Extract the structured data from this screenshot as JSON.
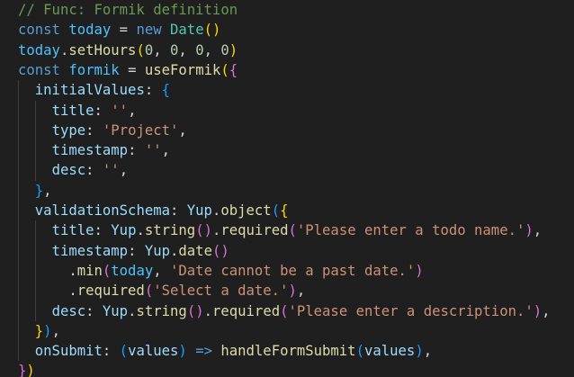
{
  "editor": {
    "theme": {
      "background": "#1f1f1f",
      "comment": "#6a9955",
      "keyword": "#569cd6",
      "variable": "#4fc1ff",
      "property": "#9cdcfe",
      "function": "#dcdcaa",
      "class": "#4ec9b0",
      "number": "#b5cea8",
      "string": "#ce9178",
      "bracket_level_1": "#ffd700",
      "bracket_level_2": "#da70d6",
      "bracket_level_3": "#179fff"
    },
    "lines": [
      [
        [
          "comment",
          "// Func: Formik definition"
        ]
      ],
      [
        [
          "keyword",
          "const "
        ],
        [
          "var",
          "today"
        ],
        [
          "op",
          " = "
        ],
        [
          "keyword",
          "new "
        ],
        [
          "class",
          "Date"
        ],
        [
          "b1",
          "()"
        ]
      ],
      [
        [
          "var",
          "today"
        ],
        [
          "op",
          "."
        ],
        [
          "func",
          "setHours"
        ],
        [
          "b1",
          "("
        ],
        [
          "num",
          "0"
        ],
        [
          "op",
          ", "
        ],
        [
          "num",
          "0"
        ],
        [
          "op",
          ", "
        ],
        [
          "num",
          "0"
        ],
        [
          "op",
          ", "
        ],
        [
          "num",
          "0"
        ],
        [
          "b1",
          ")"
        ]
      ],
      [
        [
          "keyword",
          "const "
        ],
        [
          "var",
          "formik"
        ],
        [
          "op",
          " = "
        ],
        [
          "func",
          "useFormik"
        ],
        [
          "b1",
          "("
        ],
        [
          "b2",
          "{"
        ]
      ],
      [
        [
          "op",
          "  "
        ],
        [
          "prop",
          "initialValues"
        ],
        [
          "op",
          ": "
        ],
        [
          "b3",
          "{"
        ]
      ],
      [
        [
          "op",
          "    "
        ],
        [
          "prop",
          "title"
        ],
        [
          "op",
          ": "
        ],
        [
          "str",
          "''"
        ],
        [
          "op",
          ","
        ]
      ],
      [
        [
          "op",
          "    "
        ],
        [
          "prop",
          "type"
        ],
        [
          "op",
          ": "
        ],
        [
          "str",
          "'Project'"
        ],
        [
          "op",
          ","
        ]
      ],
      [
        [
          "op",
          "    "
        ],
        [
          "prop",
          "timestamp"
        ],
        [
          "op",
          ": "
        ],
        [
          "str",
          "''"
        ],
        [
          "op",
          ","
        ]
      ],
      [
        [
          "op",
          "    "
        ],
        [
          "prop",
          "desc"
        ],
        [
          "op",
          ": "
        ],
        [
          "str",
          "''"
        ],
        [
          "op",
          ","
        ]
      ],
      [
        [
          "op",
          "  "
        ],
        [
          "b3",
          "}"
        ],
        [
          "op",
          ","
        ]
      ],
      [
        [
          "op",
          "  "
        ],
        [
          "prop",
          "validationSchema"
        ],
        [
          "op",
          ": "
        ],
        [
          "prop",
          "Yup"
        ],
        [
          "op",
          "."
        ],
        [
          "func",
          "object"
        ],
        [
          "b3",
          "("
        ],
        [
          "b1",
          "{"
        ]
      ],
      [
        [
          "op",
          "    "
        ],
        [
          "prop",
          "title"
        ],
        [
          "op",
          ": "
        ],
        [
          "prop",
          "Yup"
        ],
        [
          "op",
          "."
        ],
        [
          "func",
          "string"
        ],
        [
          "b2",
          "()"
        ],
        [
          "op",
          "."
        ],
        [
          "func",
          "required"
        ],
        [
          "b2",
          "("
        ],
        [
          "str",
          "'Please enter a todo name.'"
        ],
        [
          "b2",
          ")"
        ],
        [
          "op",
          ","
        ]
      ],
      [
        [
          "op",
          "    "
        ],
        [
          "prop",
          "timestamp"
        ],
        [
          "op",
          ": "
        ],
        [
          "prop",
          "Yup"
        ],
        [
          "op",
          "."
        ],
        [
          "func",
          "date"
        ],
        [
          "b2",
          "()"
        ]
      ],
      [
        [
          "op",
          "      ."
        ],
        [
          "func",
          "min"
        ],
        [
          "b2",
          "("
        ],
        [
          "var",
          "today"
        ],
        [
          "op",
          ", "
        ],
        [
          "str",
          "'Date cannot be a past date.'"
        ],
        [
          "b2",
          ")"
        ]
      ],
      [
        [
          "op",
          "      ."
        ],
        [
          "func",
          "required"
        ],
        [
          "b2",
          "("
        ],
        [
          "str",
          "'Select a date.'"
        ],
        [
          "b2",
          ")"
        ],
        [
          "op",
          ","
        ]
      ],
      [
        [
          "op",
          "    "
        ],
        [
          "prop",
          "desc"
        ],
        [
          "op",
          ": "
        ],
        [
          "prop",
          "Yup"
        ],
        [
          "op",
          "."
        ],
        [
          "func",
          "string"
        ],
        [
          "b2",
          "()"
        ],
        [
          "op",
          "."
        ],
        [
          "func",
          "required"
        ],
        [
          "b2",
          "("
        ],
        [
          "str",
          "'Please enter a description.'"
        ],
        [
          "b2",
          ")"
        ],
        [
          "op",
          ","
        ]
      ],
      [
        [
          "op",
          "  "
        ],
        [
          "b1",
          "}"
        ],
        [
          "b3",
          ")"
        ],
        [
          "op",
          ","
        ]
      ],
      [
        [
          "op",
          "  "
        ],
        [
          "prop",
          "onSubmit"
        ],
        [
          "op",
          ": "
        ],
        [
          "b3",
          "("
        ],
        [
          "prop",
          "values"
        ],
        [
          "b3",
          ")"
        ],
        [
          "op",
          " "
        ],
        [
          "keyword",
          "=>"
        ],
        [
          "op",
          " "
        ],
        [
          "func",
          "handleFormSubmit"
        ],
        [
          "b3",
          "("
        ],
        [
          "prop",
          "values"
        ],
        [
          "b3",
          ")"
        ],
        [
          "op",
          ","
        ]
      ],
      [
        [
          "b2",
          "}"
        ],
        [
          "b1",
          ")"
        ]
      ]
    ]
  }
}
